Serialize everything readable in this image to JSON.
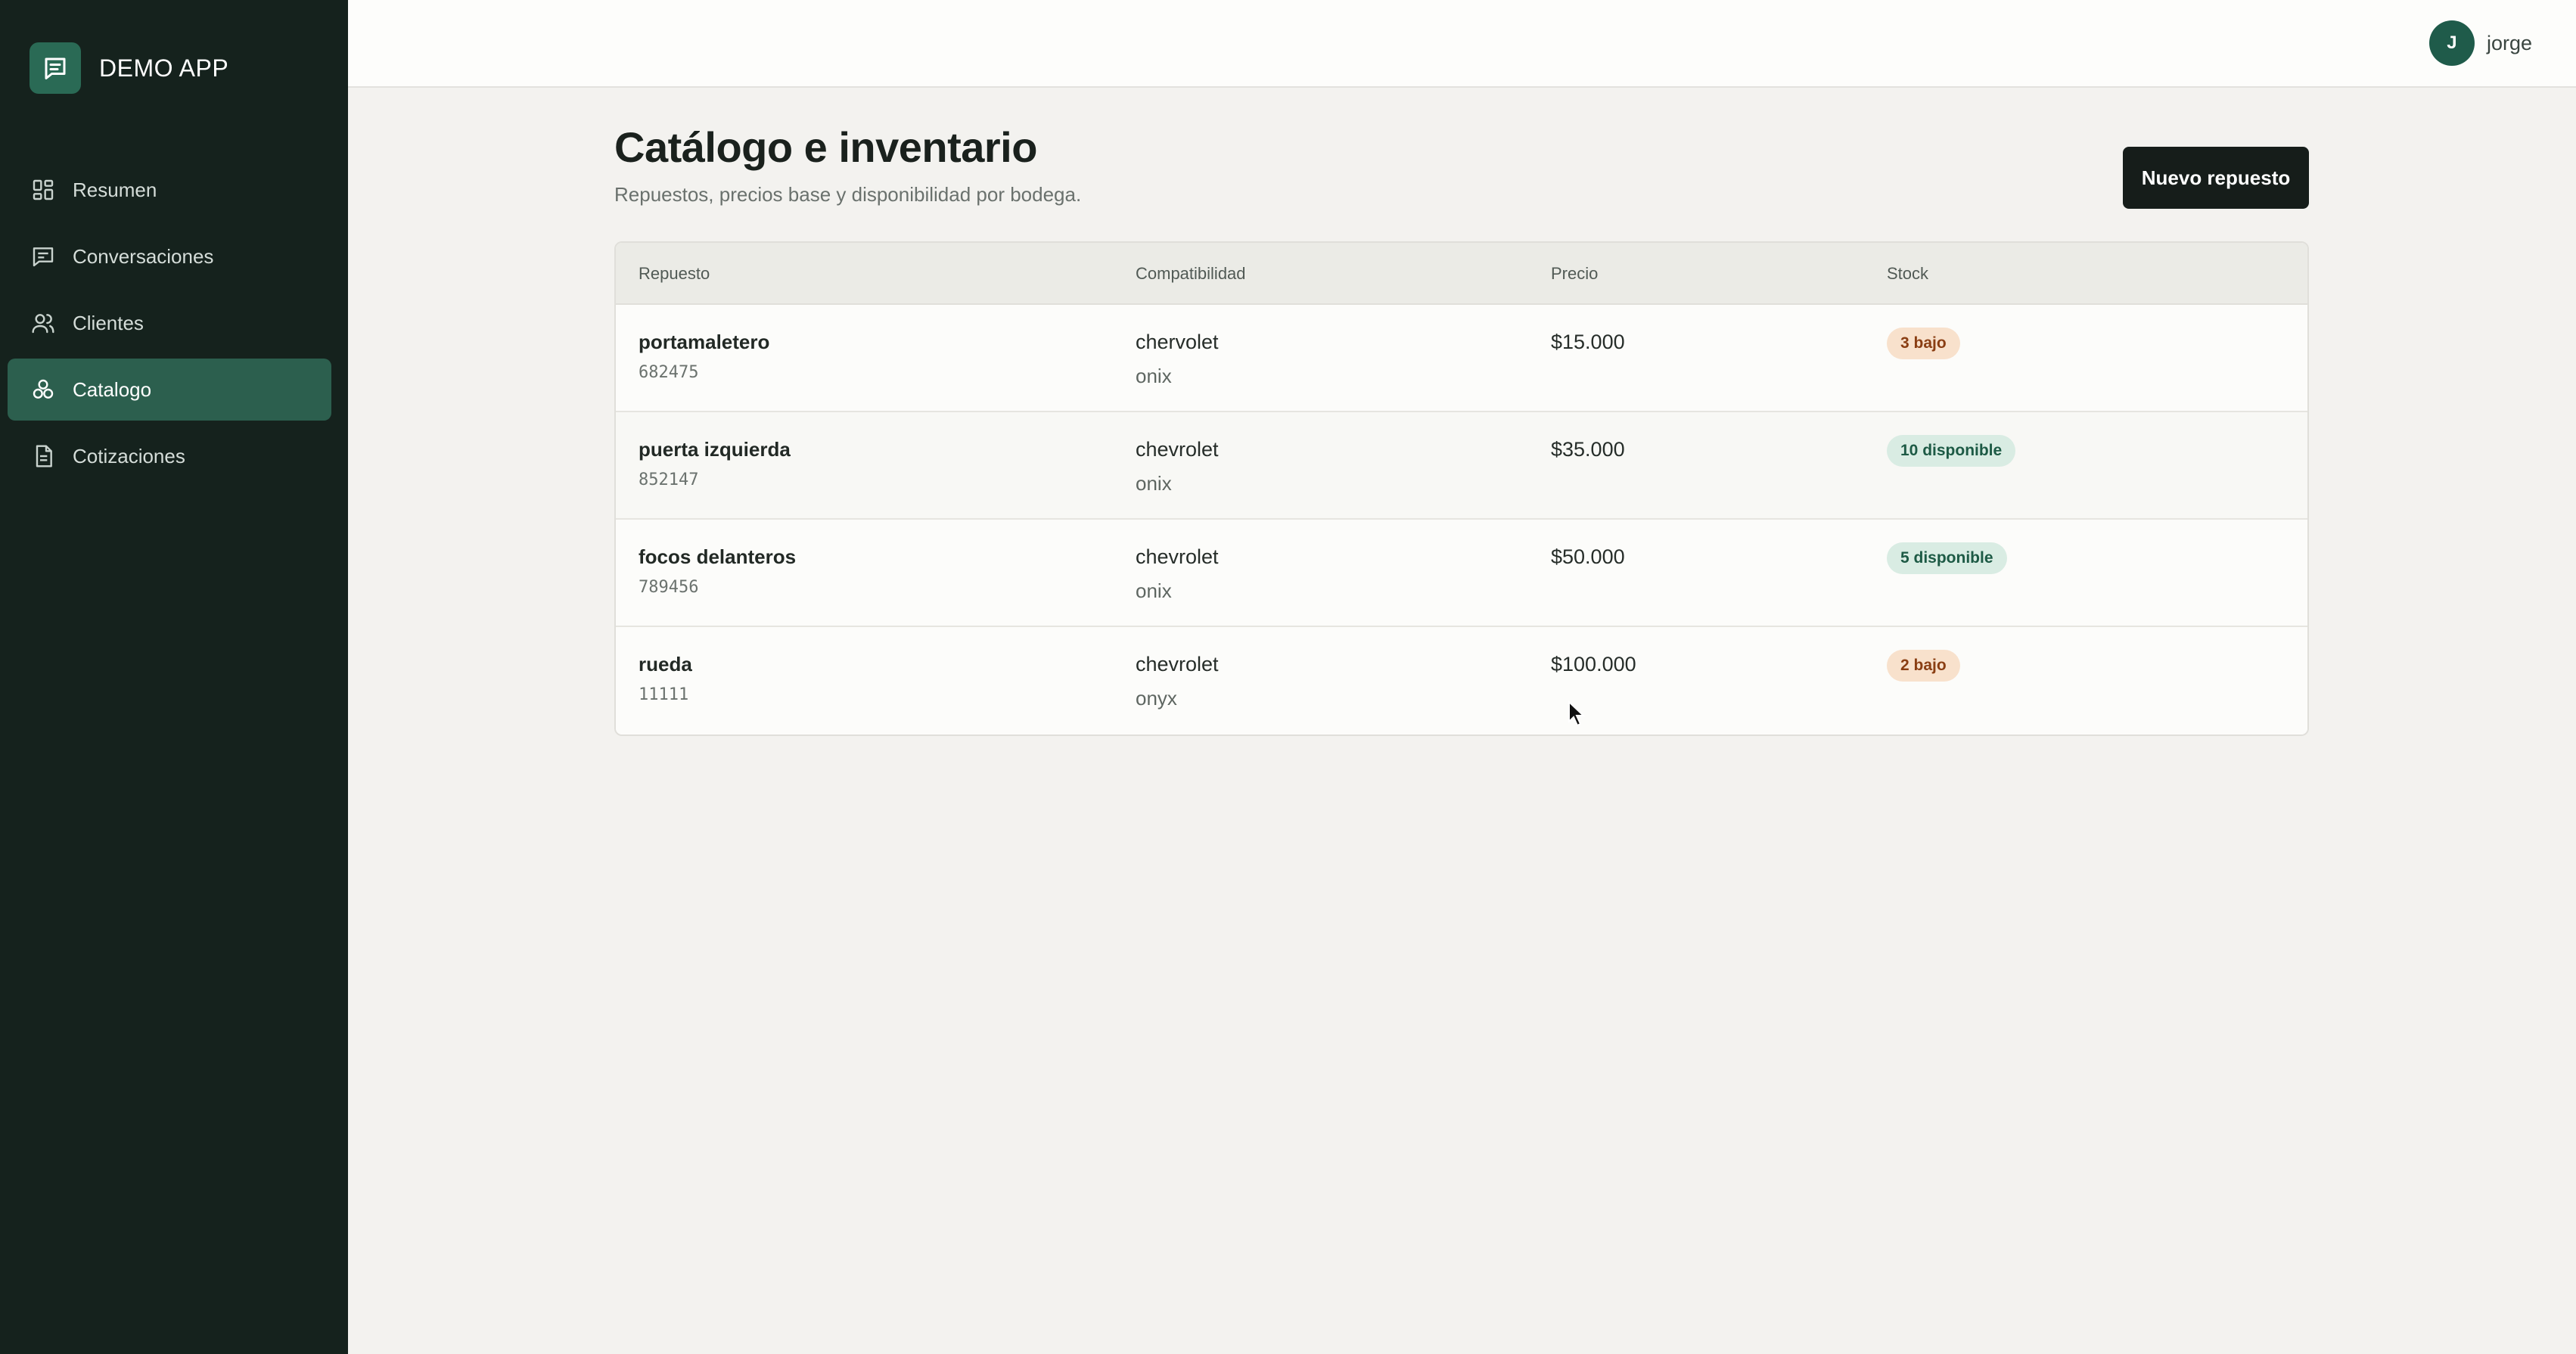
{
  "brand": {
    "name": "DEMO APP",
    "logo_icon": "chat-lines-icon"
  },
  "sidebar": {
    "items": [
      {
        "label": "Resumen",
        "icon": "dashboard-grid-icon",
        "active": false
      },
      {
        "label": "Conversaciones",
        "icon": "message-square-icon",
        "active": false
      },
      {
        "label": "Clientes",
        "icon": "users-icon",
        "active": false
      },
      {
        "label": "Catalogo",
        "icon": "catalog-circles-icon",
        "active": true
      },
      {
        "label": "Cotizaciones",
        "icon": "document-icon",
        "active": false
      }
    ]
  },
  "topbar": {
    "user": {
      "initial": "J",
      "name": "jorge"
    }
  },
  "page": {
    "title": "Catálogo e inventario",
    "subtitle": "Repuestos, precios base y disponibilidad por bodega.",
    "primary_action": "Nuevo repuesto"
  },
  "table": {
    "columns": [
      "Repuesto",
      "Compatibilidad",
      "Precio",
      "Stock"
    ],
    "rows": [
      {
        "name": "portamaletero",
        "code": "682475",
        "make": "chervolet",
        "model": "onix",
        "price": "$15.000",
        "stock": "3 bajo",
        "stock_status": "low"
      },
      {
        "name": "puerta izquierda",
        "code": "852147",
        "make": "chevrolet",
        "model": "onix",
        "price": "$35.000",
        "stock": "10 disponible",
        "stock_status": "ok"
      },
      {
        "name": "focos delanteros",
        "code": "789456",
        "make": "chevrolet",
        "model": "onix",
        "price": "$50.000",
        "stock": "5 disponible",
        "stock_status": "ok"
      },
      {
        "name": "rueda",
        "code": "11111",
        "make": "chevrolet",
        "model": "onyx",
        "price": "$100.000",
        "stock": "2 bajo",
        "stock_status": "low"
      }
    ]
  },
  "colors": {
    "sidebar_bg": "#15221d",
    "sidebar_active": "#2c5f4e",
    "brand_logo": "#2a6a55",
    "primary_button": "#161d1a",
    "badge_low_bg": "#f8e1cc",
    "badge_ok_bg": "#d9ece3"
  }
}
